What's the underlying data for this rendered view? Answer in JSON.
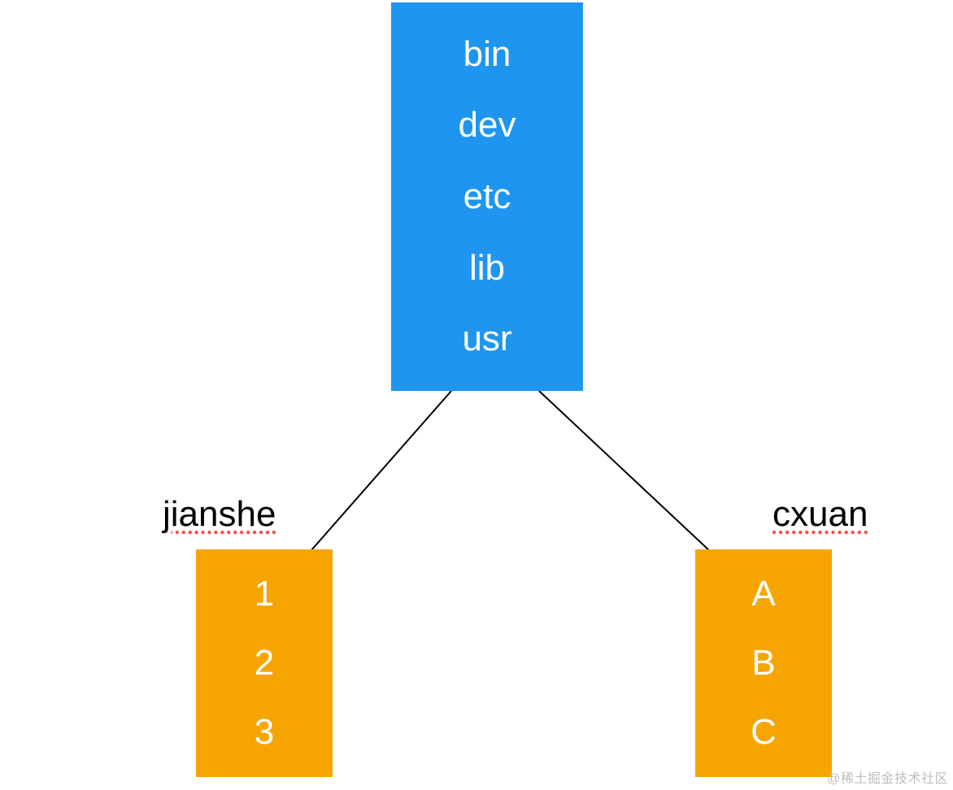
{
  "root": {
    "items": [
      "bin",
      "dev",
      "etc",
      "lib",
      "usr"
    ]
  },
  "children": {
    "left": {
      "label": "jianshe",
      "items": [
        "1",
        "2",
        "3"
      ]
    },
    "right": {
      "label": "cxuan",
      "items": [
        "A",
        "B",
        "C"
      ]
    }
  },
  "watermark": "@稀土掘金技术社区",
  "colors": {
    "root_bg": "#1E96EF",
    "child_bg": "#F6A500",
    "text": "#ffffff"
  }
}
